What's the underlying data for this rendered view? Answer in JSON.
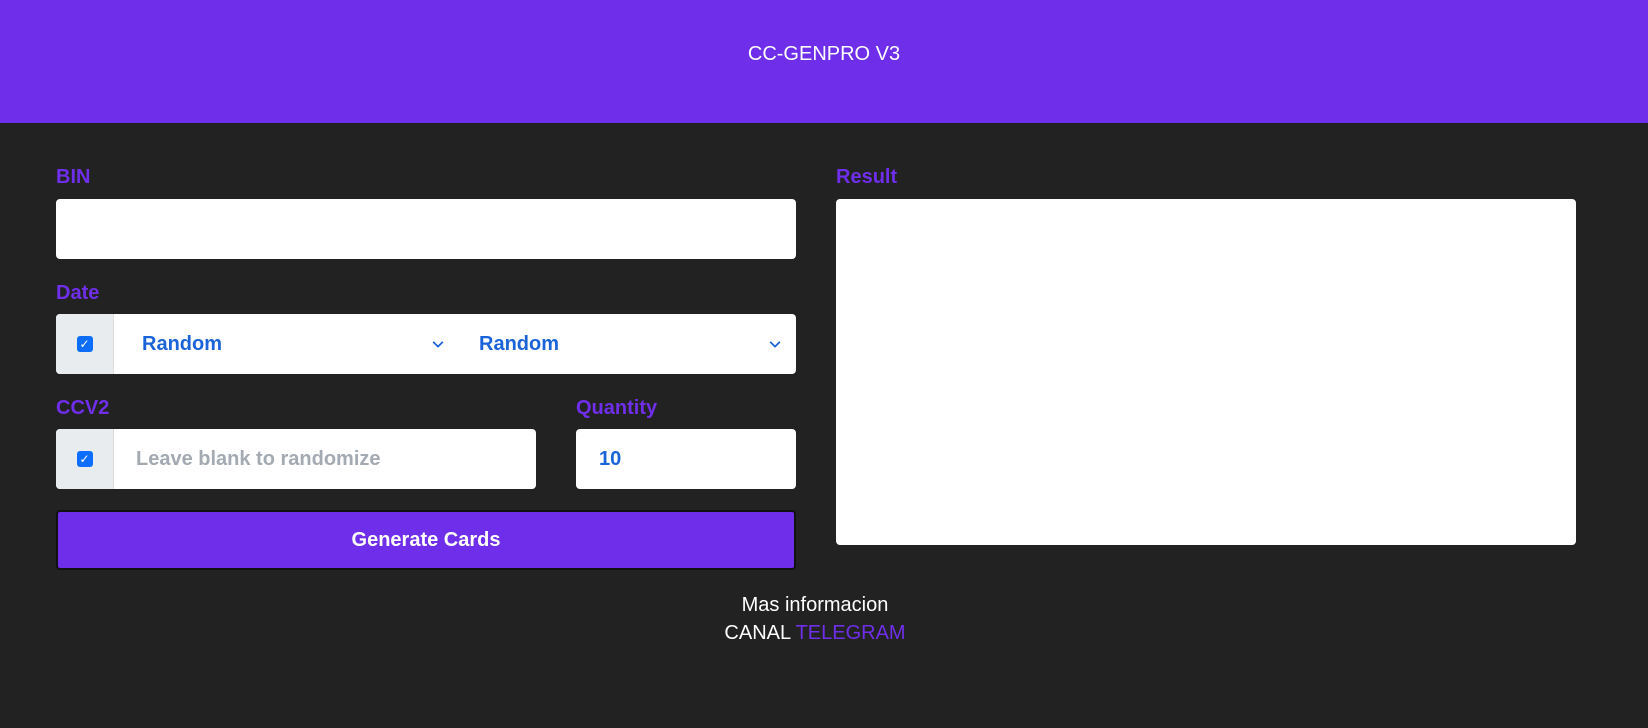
{
  "header": {
    "title": "CC-GENPRO V3"
  },
  "form": {
    "bin_label": "BIN",
    "bin_value": "",
    "date_label": "Date",
    "date_enabled": true,
    "month_select": "Random",
    "year_select": "Random",
    "ccv_label": "CCV2",
    "ccv_enabled": true,
    "ccv_placeholder": "Leave blank to randomize",
    "quantity_label": "Quantity",
    "quantity_value": "10",
    "generate_label": "Generate Cards"
  },
  "result": {
    "label": "Result",
    "value": ""
  },
  "footer": {
    "info_text": "Mas informacion",
    "canal_text": "CANAL",
    "telegram_link": "TELEGRAM"
  },
  "colors": {
    "accent": "#6f2ee9",
    "background": "#222222",
    "select_text": "#1b63d8",
    "checkbox": "#0d6efd"
  },
  "icons": [
    "checkbox-checked-icon",
    "chevron-down-icon"
  ]
}
